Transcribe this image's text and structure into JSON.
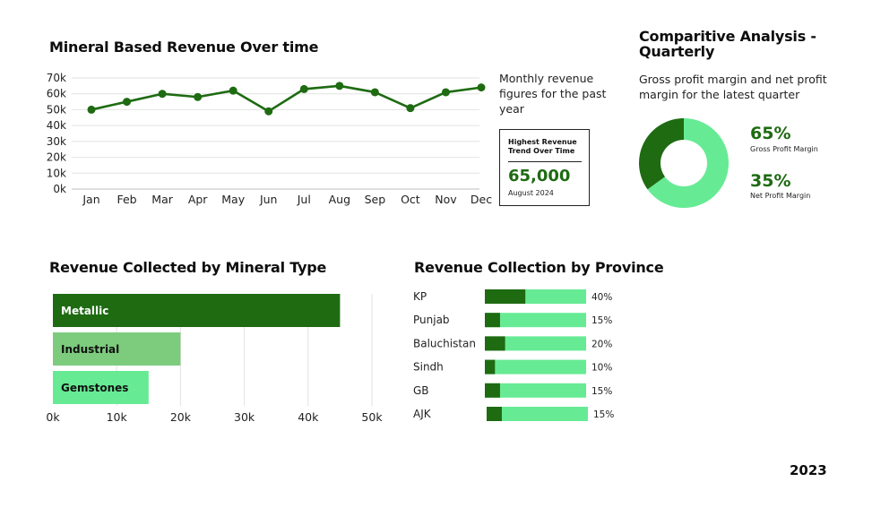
{
  "line_section": {
    "title": "Mineral Based Revenue Over time",
    "description": "Monthly revenue figures for the past year",
    "highlight": {
      "label": "Highest Revenue Trend Over Time",
      "value": "65,000",
      "date": "August 2024"
    }
  },
  "donut_section": {
    "title": "Comparitive Analysis - Quarterly",
    "description": "Gross profit margin and net profit margin for the latest quarter",
    "gross": {
      "value": "65%",
      "label": "Gross Profit Margin"
    },
    "net": {
      "value": "35%",
      "label": "Net Profit Margin"
    }
  },
  "mineral_section": {
    "title": "Revenue Collected by Mineral Type"
  },
  "province_section": {
    "title": "Revenue Collection by Province"
  },
  "footer": {
    "year": "2023"
  },
  "colors": {
    "dark": "#1e6b12",
    "mid": "#7dcb7d",
    "light": "#66eb94"
  },
  "chart_data": [
    {
      "type": "line",
      "title": "Mineral Based Revenue Over time",
      "categories": [
        "Jan",
        "Feb",
        "Mar",
        "Apr",
        "May",
        "Jun",
        "Jul",
        "Aug",
        "Sep",
        "Oct",
        "Nov",
        "Dec"
      ],
      "values": [
        50,
        55,
        60,
        58,
        62,
        49,
        63,
        65,
        61,
        51,
        61,
        64
      ],
      "unit": "k",
      "yticks": [
        "0k",
        "10k",
        "20k",
        "30k",
        "40k",
        "50k",
        "60k",
        "70k"
      ],
      "ylim": [
        0,
        70
      ],
      "grid": true
    },
    {
      "type": "pie",
      "title": "Comparitive Analysis - Quarterly",
      "categories": [
        "Gross Profit Margin",
        "Net Profit Margin"
      ],
      "values": [
        65,
        35
      ]
    },
    {
      "type": "bar",
      "orientation": "horizontal",
      "title": "Revenue Collected by Mineral Type",
      "categories": [
        "Metallic",
        "Industrial",
        "Gemstones"
      ],
      "values": [
        45,
        20,
        15
      ],
      "xticks": [
        "0k",
        "10k",
        "20k",
        "30k",
        "40k",
        "50k"
      ],
      "xlim": [
        0,
        50
      ],
      "grid": true
    },
    {
      "type": "bar",
      "orientation": "horizontal",
      "stacked": true,
      "title": "Revenue Collection by Province",
      "categories": [
        "KP",
        "Punjab",
        "Baluchistan",
        "Sindh",
        "GB",
        "AJK"
      ],
      "values": [
        40,
        15,
        20,
        10,
        15,
        15
      ],
      "value_labels": [
        "40%",
        "15%",
        "20%",
        "10%",
        "15%",
        "15%"
      ],
      "max": 100
    }
  ]
}
